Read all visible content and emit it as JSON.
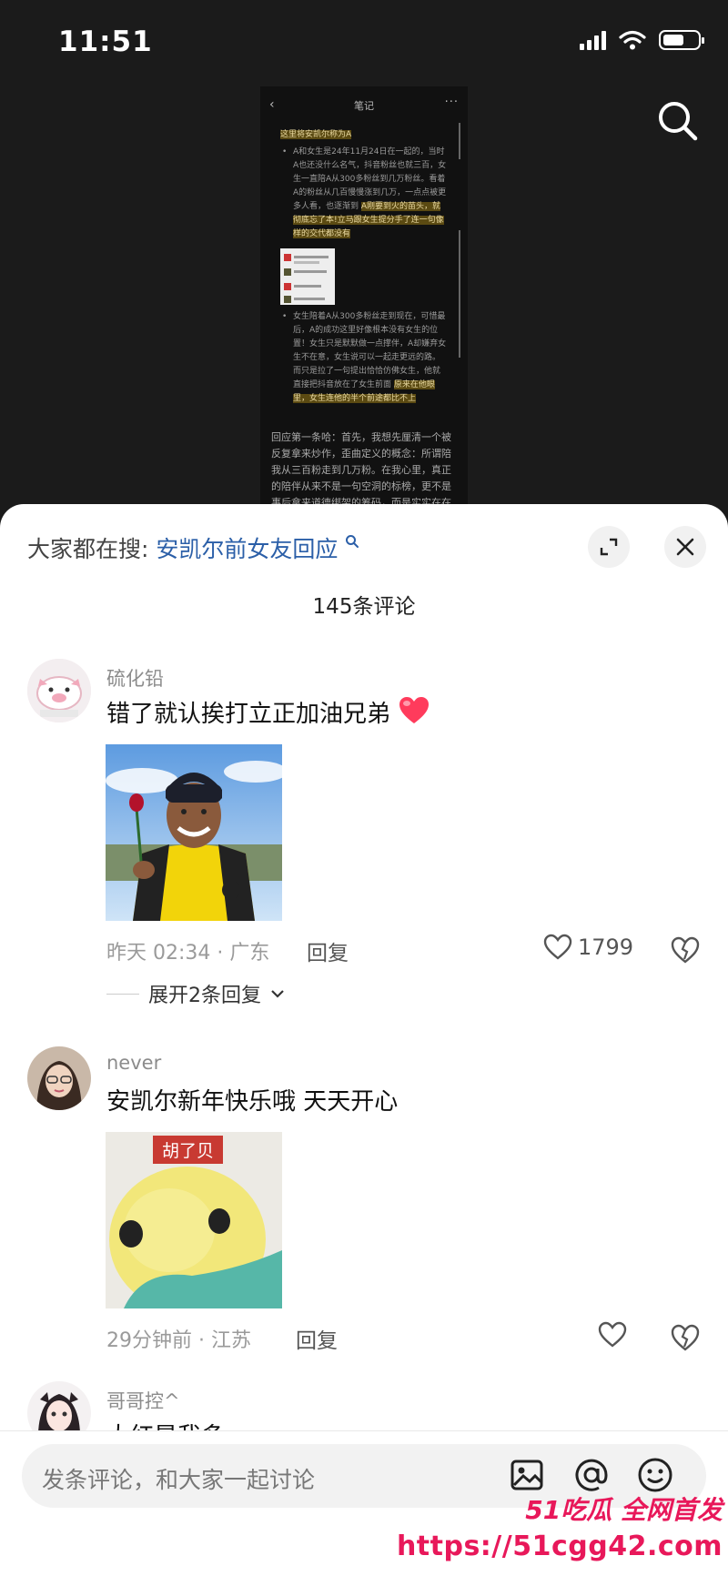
{
  "status_bar": {
    "time": "11:51"
  },
  "note": {
    "title": "笔记",
    "intro": "这里将安凯尔称为A",
    "bullet1": "A和女生是24年11月24日在一起的，当时A也还没什么名气，抖音粉丝也就三百，女生一直陪A从300多粉丝到几万粉丝。看着A的粉丝从几百慢慢涨到几万，一点点被更多人看，也逐渐到",
    "bullet1_hl": "A刚要到火的苗头，就彻底忘了本!立马跟女生提分手了连一句像样的交代都没有",
    "bullet2": "女生陪着A从300多粉丝走到现在，可惜最后，A的成功这里好像根本没有女生的位置！女生只是默默做一点撑伴，A却嫌弃女生不在意，女生说可以一起走更远的路。而只是拉了一句提出恰恰仿佛女生，他就直接把抖音放在了女生前面",
    "bullet2_hl": "原来在他眼里，女生连他的半个前途都比不上",
    "para": "回应第一条哈：首先，我想先厘清一个被反复拿来炒作，歪曲定义的概念：所谓陪我从三百粉走到几万粉。在我心里，真正的陪伴从来不是一句空洞的标榜，更不是事后拿来道德绑架的筹码，而是实实在在的行动支持，双向的理解包容，真心实意"
  },
  "panel": {
    "search_prefix": "大家都在搜:",
    "search_keyword": "安凯尔前女友回应",
    "comment_count": "145条评论"
  },
  "comments": [
    {
      "name": "硫化铅",
      "text": "错了就认挨打立正加油兄弟",
      "time_loc": "昨天 02:34 · 广东",
      "reply_label": "回复",
      "likes": "1799",
      "expand": "展开2条回复"
    },
    {
      "name": "never",
      "text": "安凯尔新年快乐哦 天天开心",
      "sticker_label": "胡了贝",
      "time_loc": "29分钟前 · 江苏",
      "reply_label": "回复"
    },
    {
      "name": "哥哥控^",
      "text": "大红是我多"
    }
  ],
  "input": {
    "placeholder": "发条评论，和大家一起讨论"
  },
  "watermark": {
    "line1": "51吃瓜 全网首发",
    "line2": "https://51cgg42.com"
  },
  "colors": {
    "keyword": "#2b5fa8",
    "heart": "#ff3b5c",
    "watermark": "#e8185a"
  }
}
